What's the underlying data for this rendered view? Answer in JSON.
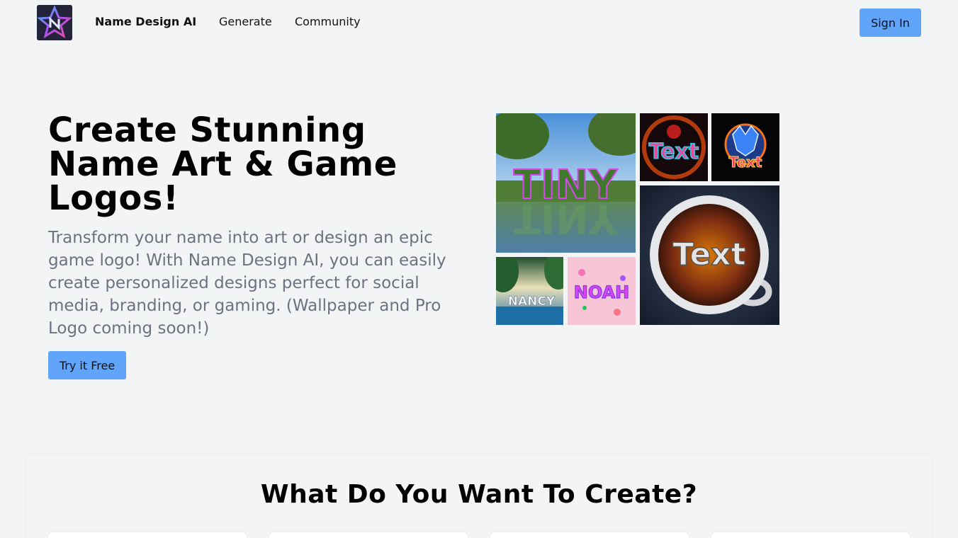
{
  "header": {
    "brand": "Name Design AI",
    "nav": {
      "generate": "Generate",
      "community": "Community"
    },
    "sign_in": "Sign In",
    "logo_icon": "star-n-logo-icon"
  },
  "hero": {
    "title": "Create Stunning Name Art & Game Logos!",
    "description": "Transform your name into art or design an epic game logo! With Name Design AI, you can easily create personalized designs perfect for social media, branding, or gaming. (Wallpaper and Pro Logo coming soon!)",
    "cta": "Try it Free"
  },
  "gallery": {
    "tiny": "TINY",
    "neon": "Text",
    "wolf": "Text",
    "coffee": "Text",
    "nancy": "NANCY",
    "noah": "NOAH"
  },
  "section": {
    "title": "What Do You Want To Create?"
  },
  "colors": {
    "accent": "#60a5fa",
    "background": "#f3f4f6",
    "muted_text": "#6b7280"
  }
}
